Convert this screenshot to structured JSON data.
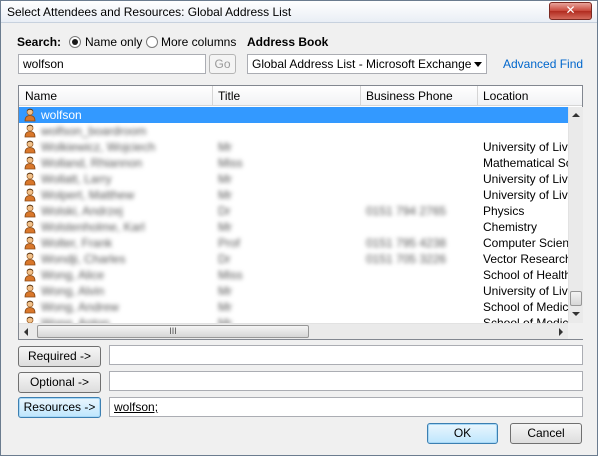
{
  "window": {
    "title": "Select Attendees and Resources: Global Address List",
    "close_glyph": "✕"
  },
  "search": {
    "label": "Search:",
    "name_only_label": "Name only",
    "more_columns_label": "More columns",
    "selected_mode": "name_only",
    "value": "wolfson",
    "go_label": "Go"
  },
  "address_book": {
    "label": "Address Book",
    "selected": "Global Address List - Microsoft Exchange",
    "advanced_find_label": "Advanced Find"
  },
  "grid": {
    "columns": [
      "Name",
      "Title",
      "Business Phone",
      "Location"
    ],
    "rows": [
      {
        "name": "wolfson",
        "title": "",
        "phone": "",
        "location": "",
        "selected": true,
        "blurred": false
      },
      {
        "name": "wolfson_boardroom",
        "title": "",
        "phone": "",
        "location": "",
        "selected": false,
        "blurred": true
      },
      {
        "name": "Wolkiewicz, Wojciech",
        "title": "Mr",
        "phone": "",
        "location": "University of Liver",
        "selected": false,
        "blurred": true
      },
      {
        "name": "Wolland, Rhiannon",
        "title": "Miss",
        "phone": "",
        "location": "Mathematical Scien",
        "selected": false,
        "blurred": true
      },
      {
        "name": "Wollatt, Larry",
        "title": "Mr",
        "phone": "",
        "location": "University of Liver",
        "selected": false,
        "blurred": true
      },
      {
        "name": "Wolpert, Matthew",
        "title": "Mr",
        "phone": "",
        "location": "University of Liver",
        "selected": false,
        "blurred": true
      },
      {
        "name": "Wolski, Andrzej",
        "title": "Dr",
        "phone": "0151 794 2765",
        "location": "Physics",
        "selected": false,
        "blurred": true
      },
      {
        "name": "Wolstenholme, Karl",
        "title": "Mr",
        "phone": "",
        "location": "Chemistry",
        "selected": false,
        "blurred": true
      },
      {
        "name": "Wolter, Frank",
        "title": "Prof",
        "phone": "0151 795 4238",
        "location": "Computer Science",
        "selected": false,
        "blurred": true
      },
      {
        "name": "Wondji, Charles",
        "title": "Dr",
        "phone": "0151 705 3226",
        "location": "Vector Research",
        "selected": false,
        "blurred": true
      },
      {
        "name": "Wong, Alice",
        "title": "Miss",
        "phone": "",
        "location": "School of Health S",
        "selected": false,
        "blurred": true
      },
      {
        "name": "Wong, Alvin",
        "title": "Mr",
        "phone": "",
        "location": "University of Liver",
        "selected": false,
        "blurred": true
      },
      {
        "name": "Wong, Andrew",
        "title": "Mr",
        "phone": "",
        "location": "School of Medicine",
        "selected": false,
        "blurred": true
      },
      {
        "name": "Wong, Anton",
        "title": "Mr",
        "phone": "",
        "location": "School of Medicine",
        "selected": false,
        "blurred": true
      }
    ],
    "hscroll_grip": "III"
  },
  "recipients": {
    "required_label": "Required ->",
    "required_value": "",
    "optional_label": "Optional ->",
    "optional_value": "",
    "resources_label": "Resources ->",
    "resources_value": "wolfson;"
  },
  "footer": {
    "ok_label": "OK",
    "cancel_label": "Cancel"
  },
  "colors": {
    "selection": "#3399ff",
    "link": "#0066cc",
    "close": "#c8473a"
  }
}
